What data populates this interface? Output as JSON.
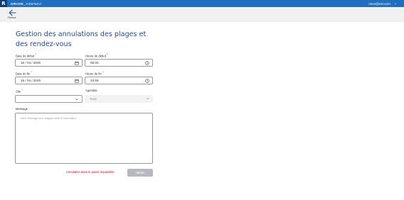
{
  "topbar": {
    "logo": "R",
    "brand_bold": "ORION",
    "brand_thin": "_AGENZA",
    "user_email": "orion@esl.com",
    "user_menu_icon": "chevron-down-icon"
  },
  "subbar": {
    "back_label": "Retour",
    "back_icon": "arrow-left-icon"
  },
  "page": {
    "title": "Gestion des annulations des plages et des rendez-vous"
  },
  "form": {
    "date_start": {
      "label": "Date de début",
      "required": "*",
      "value": "16 / 04 / 2025",
      "icon": "calendar-icon"
    },
    "time_start": {
      "label": "Heure de début",
      "required": "*",
      "value": "08:00",
      "icon": "clock-icon"
    },
    "date_end": {
      "label": "Date de fin",
      "required": "*",
      "value": "16 / 04 / 2025",
      "icon": "calendar-icon"
    },
    "time_end": {
      "label": "Heure de fin",
      "required": "*",
      "value": "23:59",
      "icon": "clock-icon"
    },
    "site": {
      "label": "Site",
      "required": "*",
      "value": "",
      "icon": "chevron-down-icon"
    },
    "agendas": {
      "label": "Agendas",
      "value": "Tous",
      "icon": "chevron-down-icon"
    },
    "message": {
      "label": "Message",
      "placeholder": "Votre message aux usagers suite à l'annulation"
    }
  },
  "footer": {
    "error_text": "Annulation dans le passé impossible",
    "submit_label": "Valider"
  },
  "colors": {
    "topbar": "#1f6fc0",
    "title": "#2a4a8a",
    "error": "#d0021b",
    "button_disabled": "#b5b9be"
  }
}
